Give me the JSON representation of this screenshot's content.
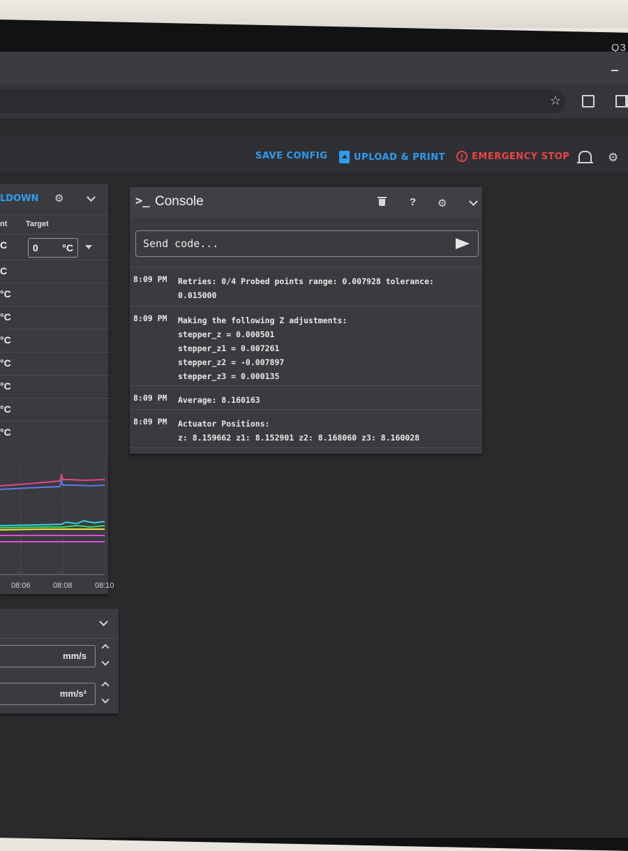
{
  "bezel": {
    "label": "Q3"
  },
  "toolbar": {
    "save_config": "SAVE CONFIG",
    "upload_print": "UPLOAD & PRINT",
    "emergency_stop": "EMERGENCY STOP",
    "accent_color": "#2f9cf0",
    "danger_color": "#e84545"
  },
  "thermal": {
    "title_fragment": "LDOWN",
    "col_actual_fragment": "nt",
    "col_target": "Target",
    "target_value": "0",
    "target_unit": "°C",
    "rows": [
      "C",
      "C",
      "°C",
      "°C",
      "°C",
      "°C",
      "°C",
      "°C",
      "°C"
    ],
    "chart": {
      "x_ticks": [
        "08:06",
        "08:08",
        "08:10"
      ],
      "series_colors": [
        "#e8458d",
        "#5a7be8",
        "#33d3ea",
        "#3ddc5a",
        "#f2e643",
        "#d84ee0"
      ]
    }
  },
  "speed": {
    "field1_unit": "mm/s",
    "field2_unit": "mm/s²"
  },
  "console": {
    "title": "Console",
    "prompt_glyph": ">_",
    "help_glyph": "?",
    "input_placeholder": "Send code...",
    "entries": [
      {
        "time": "8:09 PM",
        "text": "Retries: 0/4 Probed points range: 0.007928 tolerance:\n0.015000"
      },
      {
        "time": "8:09 PM",
        "text": "Making the following Z adjustments:\nstepper_z = 0.000501\nstepper_z1 = 0.007261\nstepper_z2 = -0.007897\nstepper_z3 = 0.000135"
      },
      {
        "time": "8:09 PM",
        "text": "Average: 8.160163"
      },
      {
        "time": "8:09 PM",
        "text": "Actuator Positions:\nz: 8.159662 z1: 8.152901 z2: 8.168060 z3: 8.160028"
      }
    ]
  }
}
